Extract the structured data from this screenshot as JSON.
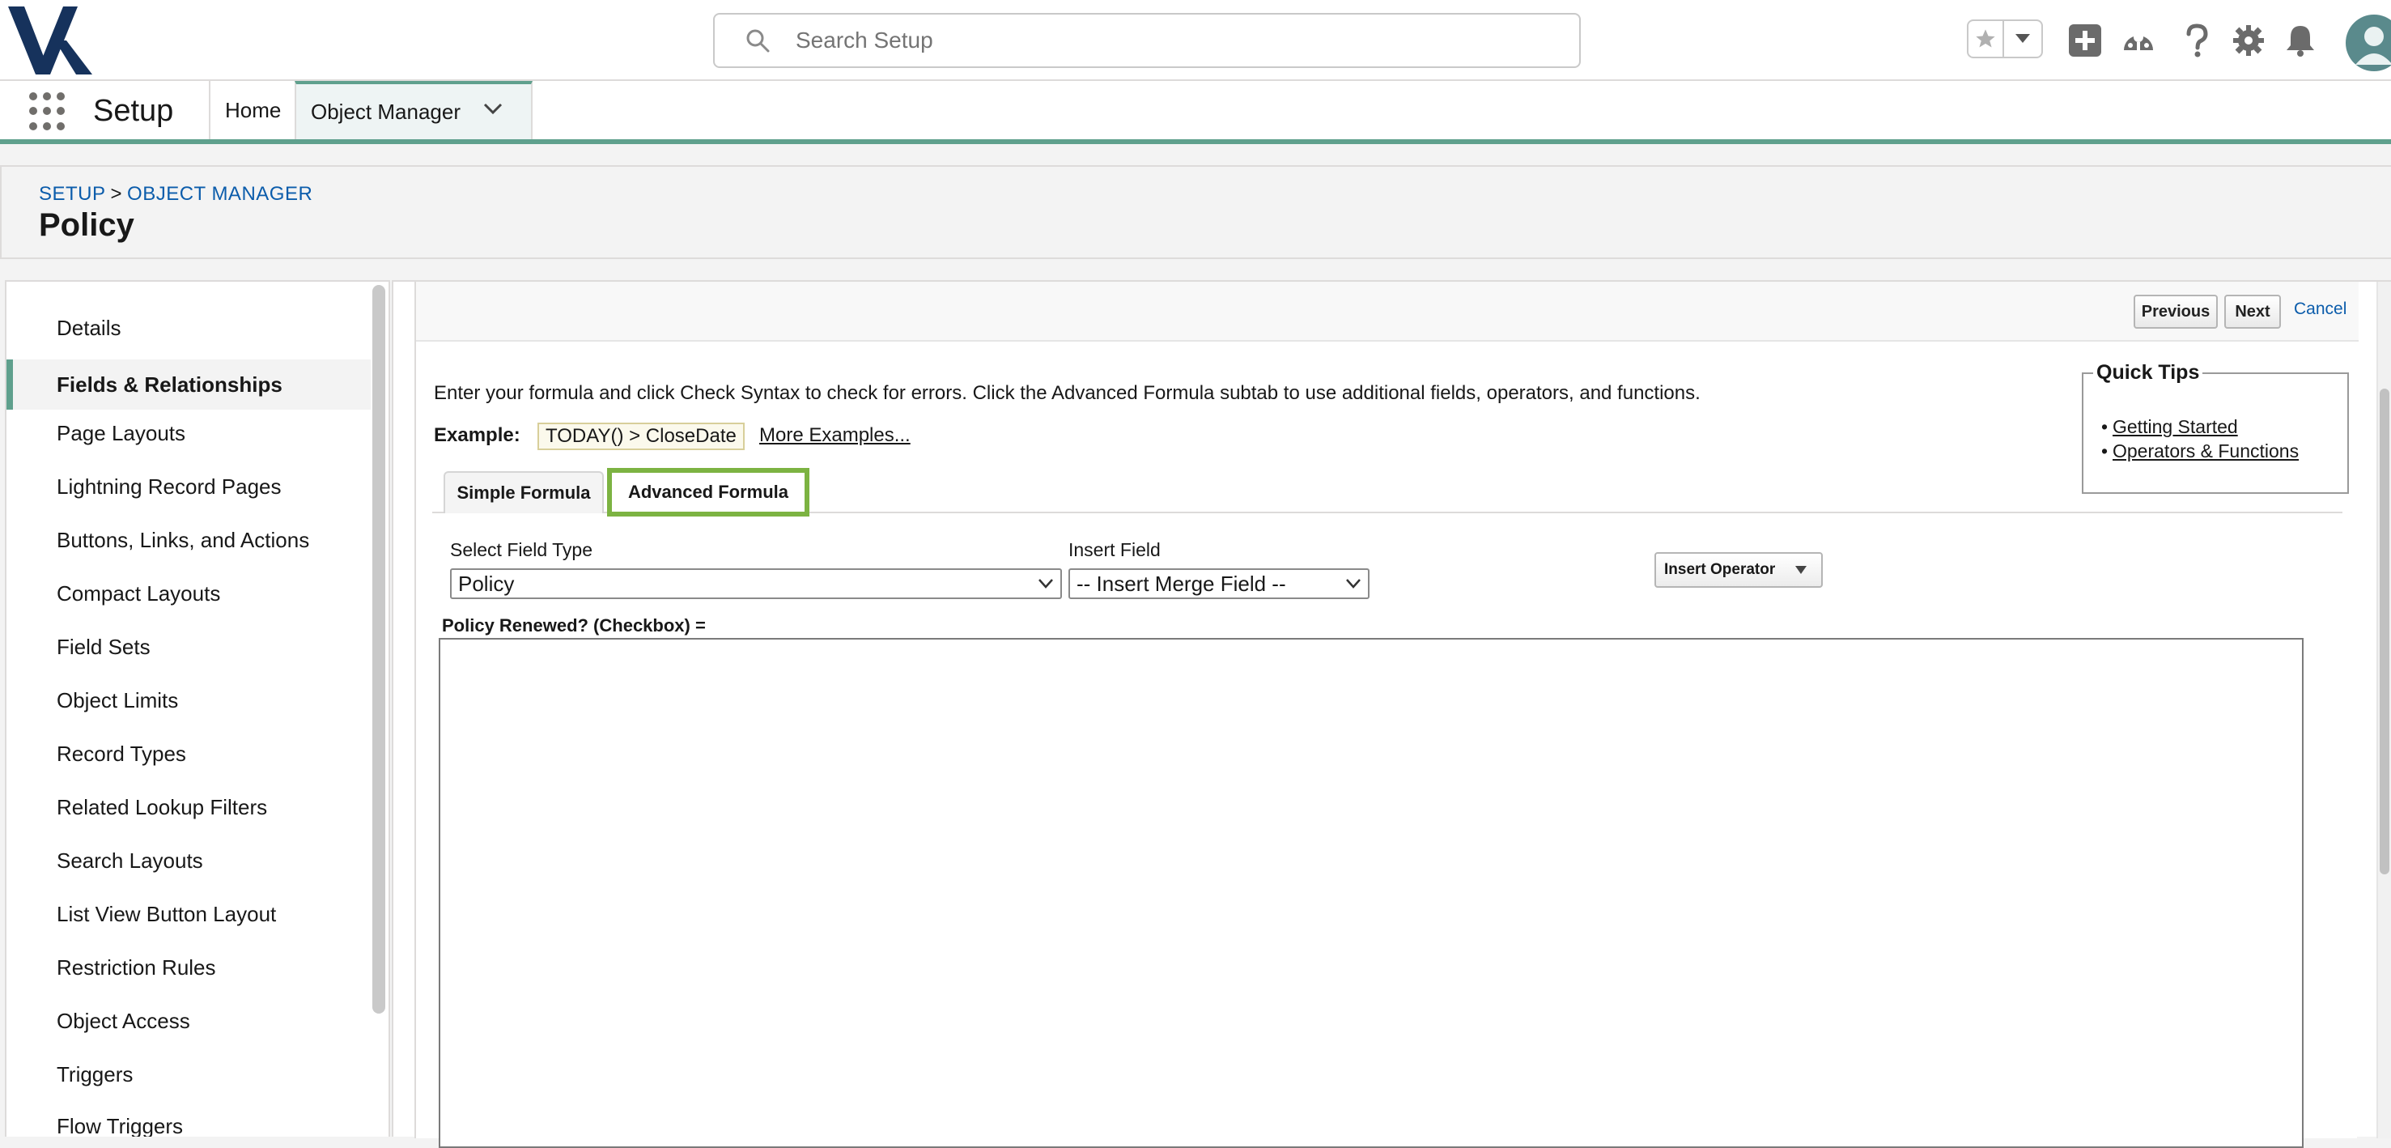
{
  "header": {
    "search_placeholder": "Search Setup"
  },
  "navbar": {
    "app_name": "Setup",
    "home_label": "Home",
    "object_manager_label": "Object Manager"
  },
  "page": {
    "breadcrumb_setup": "SETUP",
    "breadcrumb_separator": ">",
    "breadcrumb_object_manager": "OBJECT MANAGER",
    "title": "Policy"
  },
  "sidebar": {
    "items": [
      {
        "label": "Details",
        "active": false
      },
      {
        "label": "Fields & Relationships",
        "active": true
      },
      {
        "label": "Page Layouts",
        "active": false
      },
      {
        "label": "Lightning Record Pages",
        "active": false
      },
      {
        "label": "Buttons, Links, and Actions",
        "active": false
      },
      {
        "label": "Compact Layouts",
        "active": false
      },
      {
        "label": "Field Sets",
        "active": false
      },
      {
        "label": "Object Limits",
        "active": false
      },
      {
        "label": "Record Types",
        "active": false
      },
      {
        "label": "Related Lookup Filters",
        "active": false
      },
      {
        "label": "Search Layouts",
        "active": false
      },
      {
        "label": "List View Button Layout",
        "active": false
      },
      {
        "label": "Restriction Rules",
        "active": false
      },
      {
        "label": "Object Access",
        "active": false
      },
      {
        "label": "Triggers",
        "active": false
      },
      {
        "label": "Flow Triggers",
        "active": false
      }
    ]
  },
  "actions": {
    "previous": "Previous",
    "next": "Next",
    "cancel": "Cancel"
  },
  "formula": {
    "instructions": "Enter your formula and click Check Syntax to check for errors. Click the Advanced Formula subtab to use additional fields, operators, and functions.",
    "example_label": "Example:",
    "example_value": "TODAY() > CloseDate",
    "more_examples": "More Examples...",
    "tab_simple": "Simple Formula",
    "tab_advanced": "Advanced Formula",
    "select_field_type_label": "Select Field Type",
    "select_field_type_value": "Policy",
    "insert_field_label": "Insert Field",
    "insert_field_value": "-- Insert Merge Field --",
    "insert_operator": "Insert Operator",
    "formula_label": "Policy Renewed? (Checkbox) =",
    "formula_value": ""
  },
  "quick_tips": {
    "title": "Quick Tips",
    "links": [
      "Getting Started",
      "Operators & Functions"
    ]
  },
  "colors": {
    "accent": "#5fa08d",
    "link": "#0b5cab",
    "highlight": "#7cb342"
  }
}
